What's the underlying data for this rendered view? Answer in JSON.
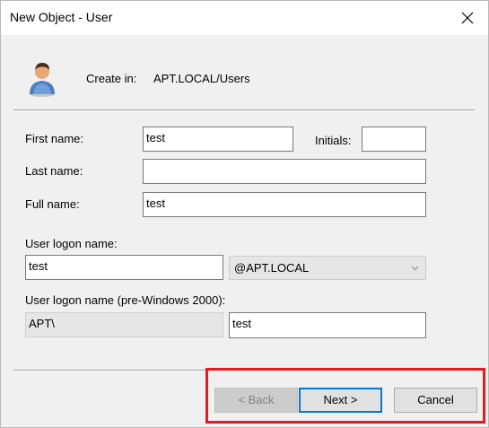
{
  "window": {
    "title": "New Object - User"
  },
  "header": {
    "create_in_label": "Create in:",
    "create_in_path": "APT.LOCAL/Users",
    "icon": "user-icon"
  },
  "form": {
    "first_name_label": "First name:",
    "first_name_value": "test",
    "initials_label": "Initials:",
    "initials_value": "",
    "last_name_label": "Last name:",
    "last_name_value": "",
    "full_name_label": "Full name:",
    "full_name_value": "test",
    "logon_name_label": "User logon name:",
    "logon_name_value": "test",
    "domain_suffix_selected": "@APT.LOCAL",
    "pre2000_label": "User logon name (pre-Windows 2000):",
    "pre2000_domain_value": "APT\\",
    "pre2000_name_value": "test"
  },
  "buttons": {
    "back_label": "< Back",
    "next_label": "Next >",
    "cancel_label": "Cancel"
  },
  "colors": {
    "highlight_border": "#e31b23",
    "default_button_border": "#0078d7"
  }
}
